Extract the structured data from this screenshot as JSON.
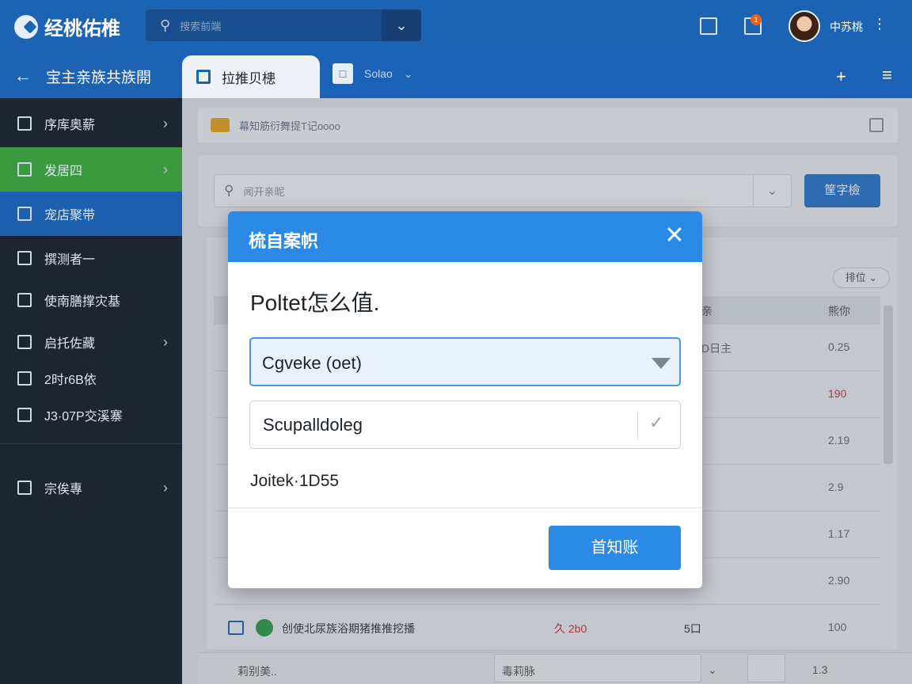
{
  "app": {
    "brand": "经桃佑椎",
    "accent": "#1d63b3",
    "success": "#3b9a3f",
    "dialog_blue": "#2a8ae6"
  },
  "topbar": {
    "search_placeholder": "搜索前端",
    "notification_count": "1",
    "user_name": "中苏桃",
    "icons": [
      "search-icon",
      "chevron-down-icon",
      "monitor-icon",
      "calendar-icon",
      "more-icon"
    ]
  },
  "nav": {
    "back_title": "宝主亲族共族開",
    "tabs": [
      {
        "label": "拉推贝槵",
        "active": true
      },
      {
        "label": "Solao",
        "active": false
      }
    ]
  },
  "sidebar": {
    "items": [
      {
        "label": "序库奥薪",
        "chevron": true
      },
      {
        "label": "发居四",
        "chevron": true,
        "state": "green"
      },
      {
        "label": "宠店聚带",
        "chevron": false,
        "state": "active"
      },
      {
        "label": "撰测者一",
        "chevron": false
      },
      {
        "label": "使南膳撑灾基",
        "chevron": false
      },
      {
        "label": "启托佐藏",
        "chevron": true
      },
      {
        "label": "2时r6B依",
        "chevron": false
      },
      {
        "label": "J3·07P交溪寨",
        "chevron": false
      },
      {
        "label": "宗俟專",
        "chevron": true
      }
    ]
  },
  "main": {
    "notice": "幕知筋衍舞提T记oooo",
    "search_placeholder": "闻开亲昵",
    "search_button": "筐字檢",
    "sort_label": "排位",
    "columns": [
      "亲",
      "熊你"
    ],
    "rows": [
      {
        "c1": "D日主",
        "c2": "0.25",
        "red": false
      },
      {
        "c1": "",
        "c2": "190",
        "red": true
      },
      {
        "c1": "",
        "c2": "2.19",
        "red": false
      },
      {
        "c1": "",
        "c2": "2.9",
        "red": false
      },
      {
        "c1": "",
        "c2": "1.17",
        "red": false
      },
      {
        "c1": "",
        "c2": "2.90",
        "red": false
      }
    ],
    "last_row": {
      "name": "创使北尿族浴期猪推推挖播",
      "price": "久 2b0",
      "qty": "5口",
      "value": "100"
    },
    "pager": {
      "left": "莉别美..",
      "mid": "毒莉脉",
      "page": "1.3"
    }
  },
  "dialog": {
    "title": "梳自案帜",
    "question": "Poltet怎么值.",
    "field1_value": "Cgveke (oet)",
    "field2_value": "Scupalldoleg",
    "meta": "Joitek·1D55",
    "ok_button": "首知账"
  }
}
